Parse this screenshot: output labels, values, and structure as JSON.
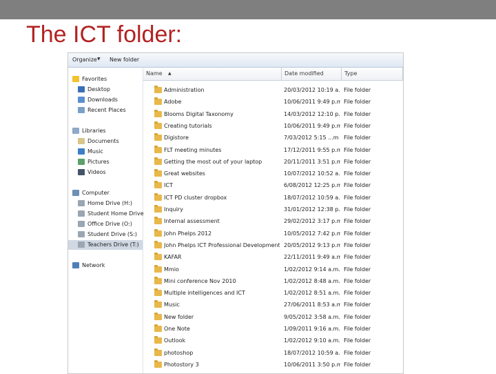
{
  "slide": {
    "title": "The ICT folder:"
  },
  "toolbar": {
    "organize": "Organize",
    "new_folder": "New folder"
  },
  "nav": {
    "favorites": {
      "label": "Favorites",
      "items": [
        "Desktop",
        "Downloads",
        "Recent Places"
      ]
    },
    "libraries": {
      "label": "Libraries",
      "items": [
        "Documents",
        "Music",
        "Pictures",
        "Videos"
      ]
    },
    "computer": {
      "label": "Computer",
      "items": [
        "Home Drive (H:)",
        "Student Home Drive",
        "Office Drive (O:)",
        "Student Drive (S:)",
        "Teachers Drive (T:)"
      ],
      "selected": "Teachers Drive (T:)"
    },
    "network": {
      "label": "Network"
    }
  },
  "columns": {
    "name": "Name",
    "date": "Date modified",
    "type": "Type"
  },
  "files": [
    {
      "name": "Administration",
      "date": "20/03/2012 10:19 a...",
      "type": "File folder"
    },
    {
      "name": "Adobe",
      "date": "10/06/2011 9:49 p.m.",
      "type": "File folder"
    },
    {
      "name": "Blooms Digital Taxonomy",
      "date": "14/03/2012 12:10 p...",
      "type": "File folder"
    },
    {
      "name": "Creating tutorials",
      "date": "10/06/2011 9:49 p.m.",
      "type": "File folder"
    },
    {
      "name": "Digistore",
      "date": "7/03/2012 5:15 ...m",
      "type": "File folder"
    },
    {
      "name": "FLT meeting minutes",
      "date": "17/12/2011 9:55 p.m.",
      "type": "File folder"
    },
    {
      "name": "Getting the most out of your laptop",
      "date": "20/11/2011 3:51 p.m.",
      "type": "File folder"
    },
    {
      "name": "Great websites",
      "date": "10/07/2012 10:52 a...",
      "type": "File folder"
    },
    {
      "name": "ICT",
      "date": "6/08/2012 12:25 p.m.",
      "type": "File folder"
    },
    {
      "name": "ICT PD cluster dropbox",
      "date": "18/07/2012 10:59 a...",
      "type": "File folder"
    },
    {
      "name": "Inquiry",
      "date": "31/01/2012 12:38 p...",
      "type": "File folder"
    },
    {
      "name": "Internal assessment",
      "date": "29/02/2012 3:17 p.m.",
      "type": "File folder"
    },
    {
      "name": "John Phelps 2012",
      "date": "10/05/2012 7:42 p.m.",
      "type": "File folder"
    },
    {
      "name": "John Phelps ICT Professional Development",
      "date": "20/05/2012 9:13 p.m.",
      "type": "File folder"
    },
    {
      "name": "KAFAR",
      "date": "22/11/2011 9:49 a.m.",
      "type": "File folder"
    },
    {
      "name": "Mmio",
      "date": "1/02/2012 9:14 a.m.",
      "type": "File folder"
    },
    {
      "name": "Mini conference Nov 2010",
      "date": "1/02/2012 8:48 a.m.",
      "type": "File folder"
    },
    {
      "name": "Multiple intelligences and ICT",
      "date": "1/02/2012 8:51 a.m.",
      "type": "File folder"
    },
    {
      "name": "Music",
      "date": "27/06/2011 8:53 a.m.",
      "type": "File folder"
    },
    {
      "name": "New folder",
      "date": "9/05/2012 3:58 a.m.",
      "type": "File folder"
    },
    {
      "name": "One Note",
      "date": "1/09/2011 9:16 a.m.",
      "type": "File folder"
    },
    {
      "name": "Outlook",
      "date": "1/02/2012 9:10 a.m.",
      "type": "File folder"
    },
    {
      "name": "photoshop",
      "date": "18/07/2012 10:59 a...",
      "type": "File folder"
    },
    {
      "name": "Photostory 3",
      "date": "10/06/2011 3:50 p.m.",
      "type": "File folder"
    }
  ],
  "colors": {
    "title": "#b22222",
    "topbar": "#7f7f7f",
    "folder": "#e8b84a",
    "selected_nav": "#cfd8e3"
  }
}
